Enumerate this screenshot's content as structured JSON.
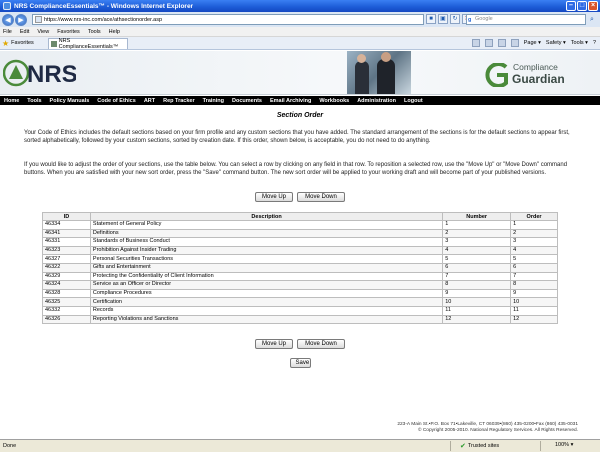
{
  "window": {
    "title": "NRS ComplianceEssentials™ - Windows Internet Explorer",
    "minimize": "–",
    "maximize": "□",
    "close": "×"
  },
  "addressbar": {
    "url": "https://www.nrs-inc.com/ace/athsectionorder.asp",
    "search_placeholder": "Google",
    "search_icon": "magnifier-icon"
  },
  "menubar": [
    "File",
    "Edit",
    "View",
    "Favorites",
    "Tools",
    "Help"
  ],
  "favorites": {
    "label": "Favorites",
    "tab_title": "NRS ComplianceEssentials™"
  },
  "commandbar": [
    "Page ▾",
    "Safety ▾",
    "Tools ▾",
    "?"
  ],
  "header": {
    "logo_text": "NRS",
    "brand_compliance": "Compliance",
    "brand_guardian": "Guardian"
  },
  "nav": [
    "Home",
    "Tools",
    "Policy Manuals",
    "Code of Ethics",
    "ART",
    "Rep Tracker",
    "Training",
    "Documents",
    "Email Archiving",
    "Workbooks",
    "Administration",
    "Logout"
  ],
  "page": {
    "title": "Section Order",
    "para1": "Your Code of Ethics includes the default sections based on your firm profile and any custom sections that you have added. The standard arrangement of the sections is for the default sections to appear first, sorted alphabetically, followed by your custom sections, sorted by creation date. If this order, shown below, is acceptable, you do not need to do anything.",
    "para2": "If you would like to adjust the order of your sections, use the table below. You can select a row by clicking on any field in that row. To reposition a selected row, use the \"Move Up\" or \"Move Down\" command buttons. When you are satisfied with your new sort order, press the \"Save\" command button. The new sort order will be applied to your working draft and will become part of your published versions.",
    "move_up": "Move Up",
    "move_down": "Move Down",
    "save": "Save"
  },
  "table": {
    "headers": [
      "ID",
      "Description",
      "Number",
      "Order"
    ],
    "rows": [
      [
        "46334",
        "Statement of General Policy",
        "1",
        "1"
      ],
      [
        "46341",
        "Definitions",
        "2",
        "2"
      ],
      [
        "46331",
        "Standards of Business Conduct",
        "3",
        "3"
      ],
      [
        "46323",
        "Prohibition Against Insider Trading",
        "4",
        "4"
      ],
      [
        "46327",
        "Personal Securities Transactions",
        "5",
        "5"
      ],
      [
        "46322",
        "Gifts and Entertainment",
        "6",
        "6"
      ],
      [
        "46329",
        "Protecting the Confidentiality of Client Information",
        "7",
        "7"
      ],
      [
        "46324",
        "Service as an Officer or Director",
        "8",
        "8"
      ],
      [
        "46328",
        "Compliance Procedures",
        "9",
        "9"
      ],
      [
        "46325",
        "Certification",
        "10",
        "10"
      ],
      [
        "46332",
        "Records",
        "11",
        "11"
      ],
      [
        "46326",
        "Reporting Violations and Sanctions",
        "12",
        "12"
      ]
    ]
  },
  "footer": {
    "line1": "223-A Main St.•P.O. Box 71•Lakeville, CT 06039•(860) 435-0200•Fax (860) 435-0031",
    "line2": "© Copyright 2005-2010. National Regulatory Services. All Rights Reserved."
  },
  "status": {
    "left": "Done",
    "zone": "Trusted sites",
    "zoom": "100% ▾"
  },
  "colors": {
    "nav_bg": "#000000",
    "brand_green": "#4a8a3a",
    "titlebar_blue": "#1c5bd6"
  }
}
